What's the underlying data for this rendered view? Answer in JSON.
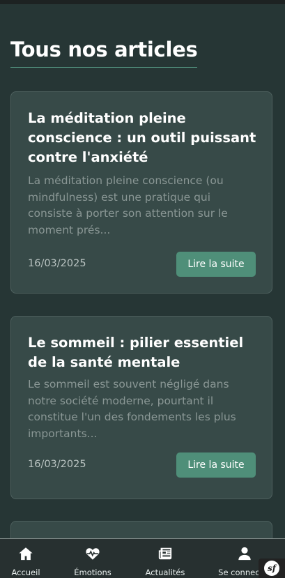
{
  "page": {
    "title": "Tous nos articles"
  },
  "articles": [
    {
      "title": "La méditation pleine conscience : un outil puissant contre l'anxiété",
      "excerpt": "La méditation pleine conscience (ou mindfulness) est une pratique qui consiste à porter son attention sur le moment prés...",
      "date": "16/03/2025",
      "button_label": "Lire la suite"
    },
    {
      "title": "Le sommeil : pilier essentiel de la santé mentale",
      "excerpt": "Le sommeil est souvent négligé dans notre société moderne, pourtant il constitue l'un des fondements les plus importants...",
      "date": "16/03/2025",
      "button_label": "Lire la suite"
    }
  ],
  "bottom_nav": {
    "items": [
      {
        "label": "Accueil",
        "icon": "home-icon"
      },
      {
        "label": "Émotions",
        "icon": "heartbeat-icon"
      },
      {
        "label": "Actualités",
        "icon": "newspaper-icon"
      },
      {
        "label": "Se connecter",
        "icon": "user-icon"
      }
    ]
  },
  "colors": {
    "background": "#263635",
    "card": "#374a48",
    "accent": "#4f8f79",
    "title_underline": "#5aa38c"
  }
}
